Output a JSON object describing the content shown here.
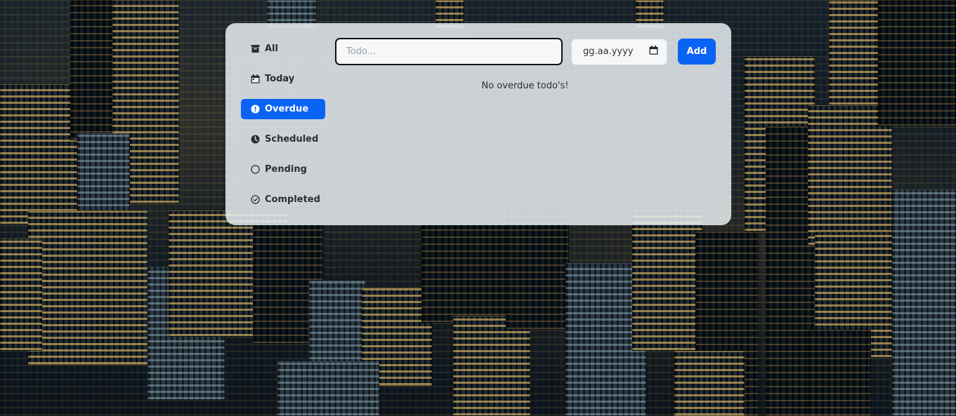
{
  "sidebar": {
    "items": [
      {
        "label": "All",
        "icon": "archive-icon"
      },
      {
        "label": "Today",
        "icon": "calendar-icon"
      },
      {
        "label": "Overdue",
        "icon": "exclamation-circle-icon",
        "active": true
      },
      {
        "label": "Scheduled",
        "icon": "clock-icon"
      },
      {
        "label": "Pending",
        "icon": "circle-icon"
      },
      {
        "label": "Completed",
        "icon": "check-circle-icon"
      }
    ]
  },
  "form": {
    "todo_placeholder": "Todo...",
    "todo_value": "",
    "date_placeholder": "gg.aa.yyyy",
    "add_label": "Add"
  },
  "main": {
    "empty_message": "No overdue todo's!"
  },
  "colors": {
    "accent": "#0b63f6",
    "panel": "#e8edf1",
    "text": "#2b2f33"
  }
}
